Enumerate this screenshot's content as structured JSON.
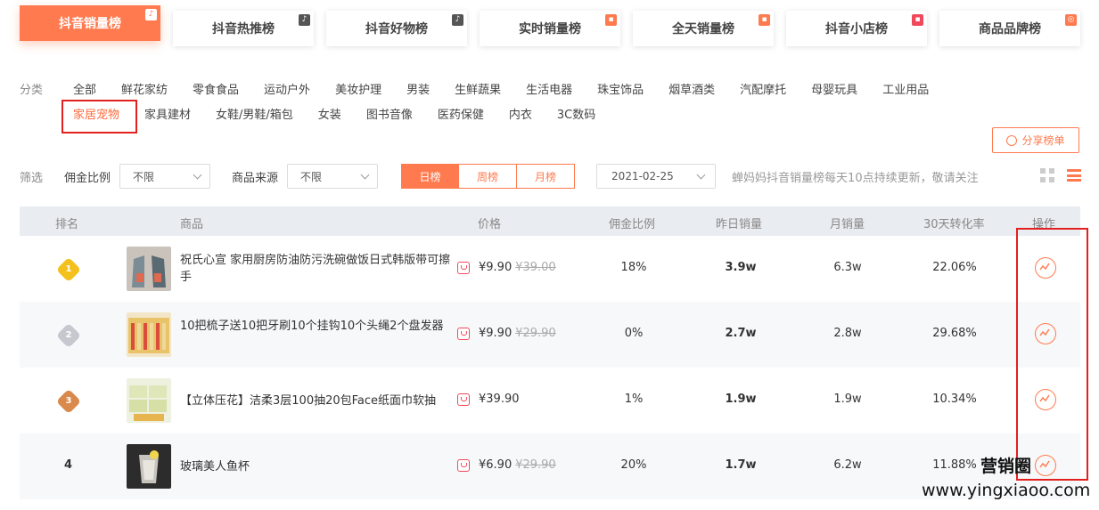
{
  "tabs": [
    {
      "label": "抖音销量榜",
      "corner": "♪",
      "corner_style": "active"
    },
    {
      "label": "抖音热推榜",
      "corner": "♪",
      "corner_style": "dark"
    },
    {
      "label": "抖音好物榜",
      "corner": "♪",
      "corner_style": "dark"
    },
    {
      "label": "实时销量榜",
      "corner": "▪",
      "corner_style": "orange"
    },
    {
      "label": "全天销量榜",
      "corner": "▪",
      "corner_style": "orange"
    },
    {
      "label": "抖音小店榜",
      "corner": "▪",
      "corner_style": "pink"
    },
    {
      "label": "商品品牌榜",
      "corner": "◎",
      "corner_style": "orange"
    }
  ],
  "categories": {
    "label": "分类",
    "row1": [
      "全部",
      "鲜花家纺",
      "零食食品",
      "运动户外",
      "美妆护理",
      "男装",
      "生鲜蔬果",
      "生活电器",
      "珠宝饰品",
      "烟草酒类",
      "汽配摩托",
      "母婴玩具",
      "工业用品"
    ],
    "row2": [
      "家居宠物",
      "家具建材",
      "女鞋/男鞋/箱包",
      "女装",
      "图书音像",
      "医药保健",
      "内衣",
      "3C数码"
    ],
    "active": "家居宠物"
  },
  "share_button": "分享榜单",
  "filter": {
    "label": "筛选",
    "commission_label": "佣金比例",
    "commission_value": "不限",
    "source_label": "商品来源",
    "source_value": "不限",
    "periods": [
      "日榜",
      "周榜",
      "月榜"
    ],
    "active_period": "日榜",
    "date": "2021-02-25",
    "notice": "蝉妈妈抖音销量榜每天10点持续更新，敬请关注"
  },
  "table": {
    "headers": {
      "rank": "排名",
      "product": "商品",
      "price": "价格",
      "commission": "佣金比例",
      "yesterday_sales": "昨日销量",
      "monthly_sales": "月销量",
      "conversion": "30天转化率",
      "action": "操作"
    },
    "rows": [
      {
        "rank": "1",
        "title": "祝氏心宣 家用厨房防油防污洗碗做饭日式韩版带可擦手",
        "price": "¥9.90",
        "orig_price": "¥39.00",
        "commission": "18%",
        "yesterday": "3.9w",
        "monthly": "6.3w",
        "conversion": "22.06%"
      },
      {
        "rank": "2",
        "title": "10把梳子送10把牙刷10个挂钩10个头绳2个盘发器",
        "price": "¥9.90",
        "orig_price": "¥29.90",
        "commission": "0%",
        "yesterday": "2.7w",
        "monthly": "2.8w",
        "conversion": "29.68%"
      },
      {
        "rank": "3",
        "title": "【立体压花】洁柔3层100抽20包Face纸面巾软抽",
        "price": "¥39.90",
        "orig_price": "",
        "commission": "1%",
        "yesterday": "1.9w",
        "monthly": "1.9w",
        "conversion": "10.34%"
      },
      {
        "rank": "4",
        "title": "玻璃美人鱼杯",
        "price": "¥6.90",
        "orig_price": "¥29.90",
        "commission": "20%",
        "yesterday": "1.7w",
        "monthly": "6.2w",
        "conversion": "11.88%"
      }
    ]
  },
  "watermark": {
    "line1": "营销圈",
    "line2": "www.yingxiaoo.com"
  },
  "colors": {
    "accent": "#ff7a4e",
    "highlight_box": "#e32020",
    "gold": "#f4c01b",
    "silver": "#c5c8cf",
    "bronze": "#d9894b"
  }
}
